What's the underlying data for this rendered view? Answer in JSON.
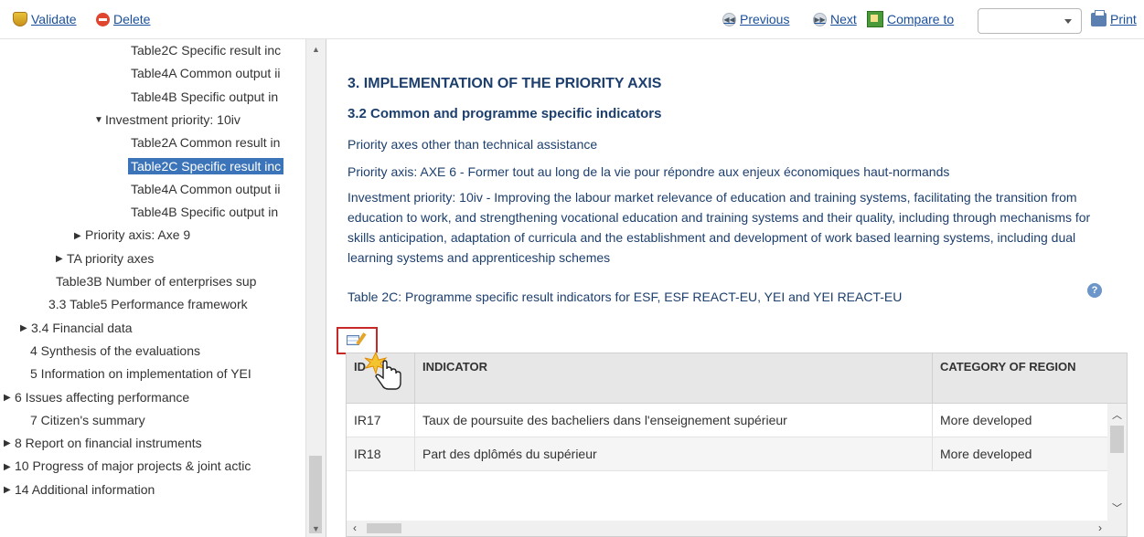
{
  "toolbar": {
    "validate_label": "Validate",
    "delete_label": "Delete",
    "previous_label": "Previous",
    "next_label": "Next",
    "compare_label": "Compare to",
    "compare_value": "",
    "print_label": "Print"
  },
  "tree": {
    "items": [
      {
        "label": "Table2C Specific result inc",
        "arrow": ""
      },
      {
        "label": "Table4A Common output ii",
        "arrow": ""
      },
      {
        "label": "Table4B Specific output in",
        "arrow": ""
      },
      {
        "label": "Investment priority: 10iv",
        "arrow": "▼"
      },
      {
        "label": "Table2A Common result in",
        "arrow": ""
      },
      {
        "label": "Table2C Specific result inc",
        "arrow": "",
        "selected": true
      },
      {
        "label": "Table4A Common output ii",
        "arrow": ""
      },
      {
        "label": "Table4B Specific output in",
        "arrow": ""
      },
      {
        "label": "Priority axis: Axe 9",
        "arrow": "▶"
      },
      {
        "label": "TA priority axes",
        "arrow": "▶"
      },
      {
        "label": "Table3B Number of enterprises sup",
        "arrow": ""
      },
      {
        "label": "3.3 Table5 Performance framework",
        "arrow": ""
      },
      {
        "label": "3.4 Financial data",
        "arrow": "▶"
      },
      {
        "label": "4 Synthesis of the evaluations",
        "arrow": ""
      },
      {
        "label": "5 Information on implementation of YEI",
        "arrow": ""
      },
      {
        "label": "6 Issues affecting performance",
        "arrow": "▶"
      },
      {
        "label": "7 Citizen's summary",
        "arrow": ""
      },
      {
        "label": "8 Report on financial instruments",
        "arrow": "▶"
      },
      {
        "label": "10 Progress of major projects & joint actic",
        "arrow": "▶"
      },
      {
        "label": "14 Additional information",
        "arrow": "▶"
      }
    ]
  },
  "main": {
    "heading": "3. IMPLEMENTATION OF THE PRIORITY AXIS",
    "subheading": "3.2 Common and programme specific indicators",
    "line1": "Priority axes other than technical assistance",
    "line2": "Priority axis: AXE 6 - Former tout au long de la vie pour répondre aux enjeux économiques haut-normands",
    "line3": "Investment priority: 10iv - Improving the labour market relevance of education and training systems, facilitating the transition from education to work, and strengthening vocational education and training systems and their quality, including through mechanisms for skills anticipation, adaptation of curricula and the establishment and development of work based learning systems, including dual learning systems and apprenticeship schemes",
    "line4": "Table 2C: Programme specific result indicators for ESF, ESF REACT-EU, YEI and YEI REACT-EU"
  },
  "table": {
    "headers": [
      "ID",
      "INDICATOR",
      "CATEGORY OF REGION"
    ],
    "rows": [
      [
        "IR17",
        "Taux de poursuite des bacheliers dans l'enseignement supérieur",
        "More developed"
      ],
      [
        "IR18",
        "Part des dplômés du supérieur",
        "More developed"
      ]
    ]
  },
  "colors": {
    "link": "#1a4f9c",
    "heading": "#1d3f6e",
    "selection": "#3b74b8",
    "highlight_border": "#c62828"
  },
  "icons": [
    "validate-icon",
    "delete-icon",
    "previous-icon",
    "next-icon",
    "compare-icon",
    "print-icon",
    "help-icon",
    "edit-grid-icon",
    "hand-cursor-icon"
  ]
}
